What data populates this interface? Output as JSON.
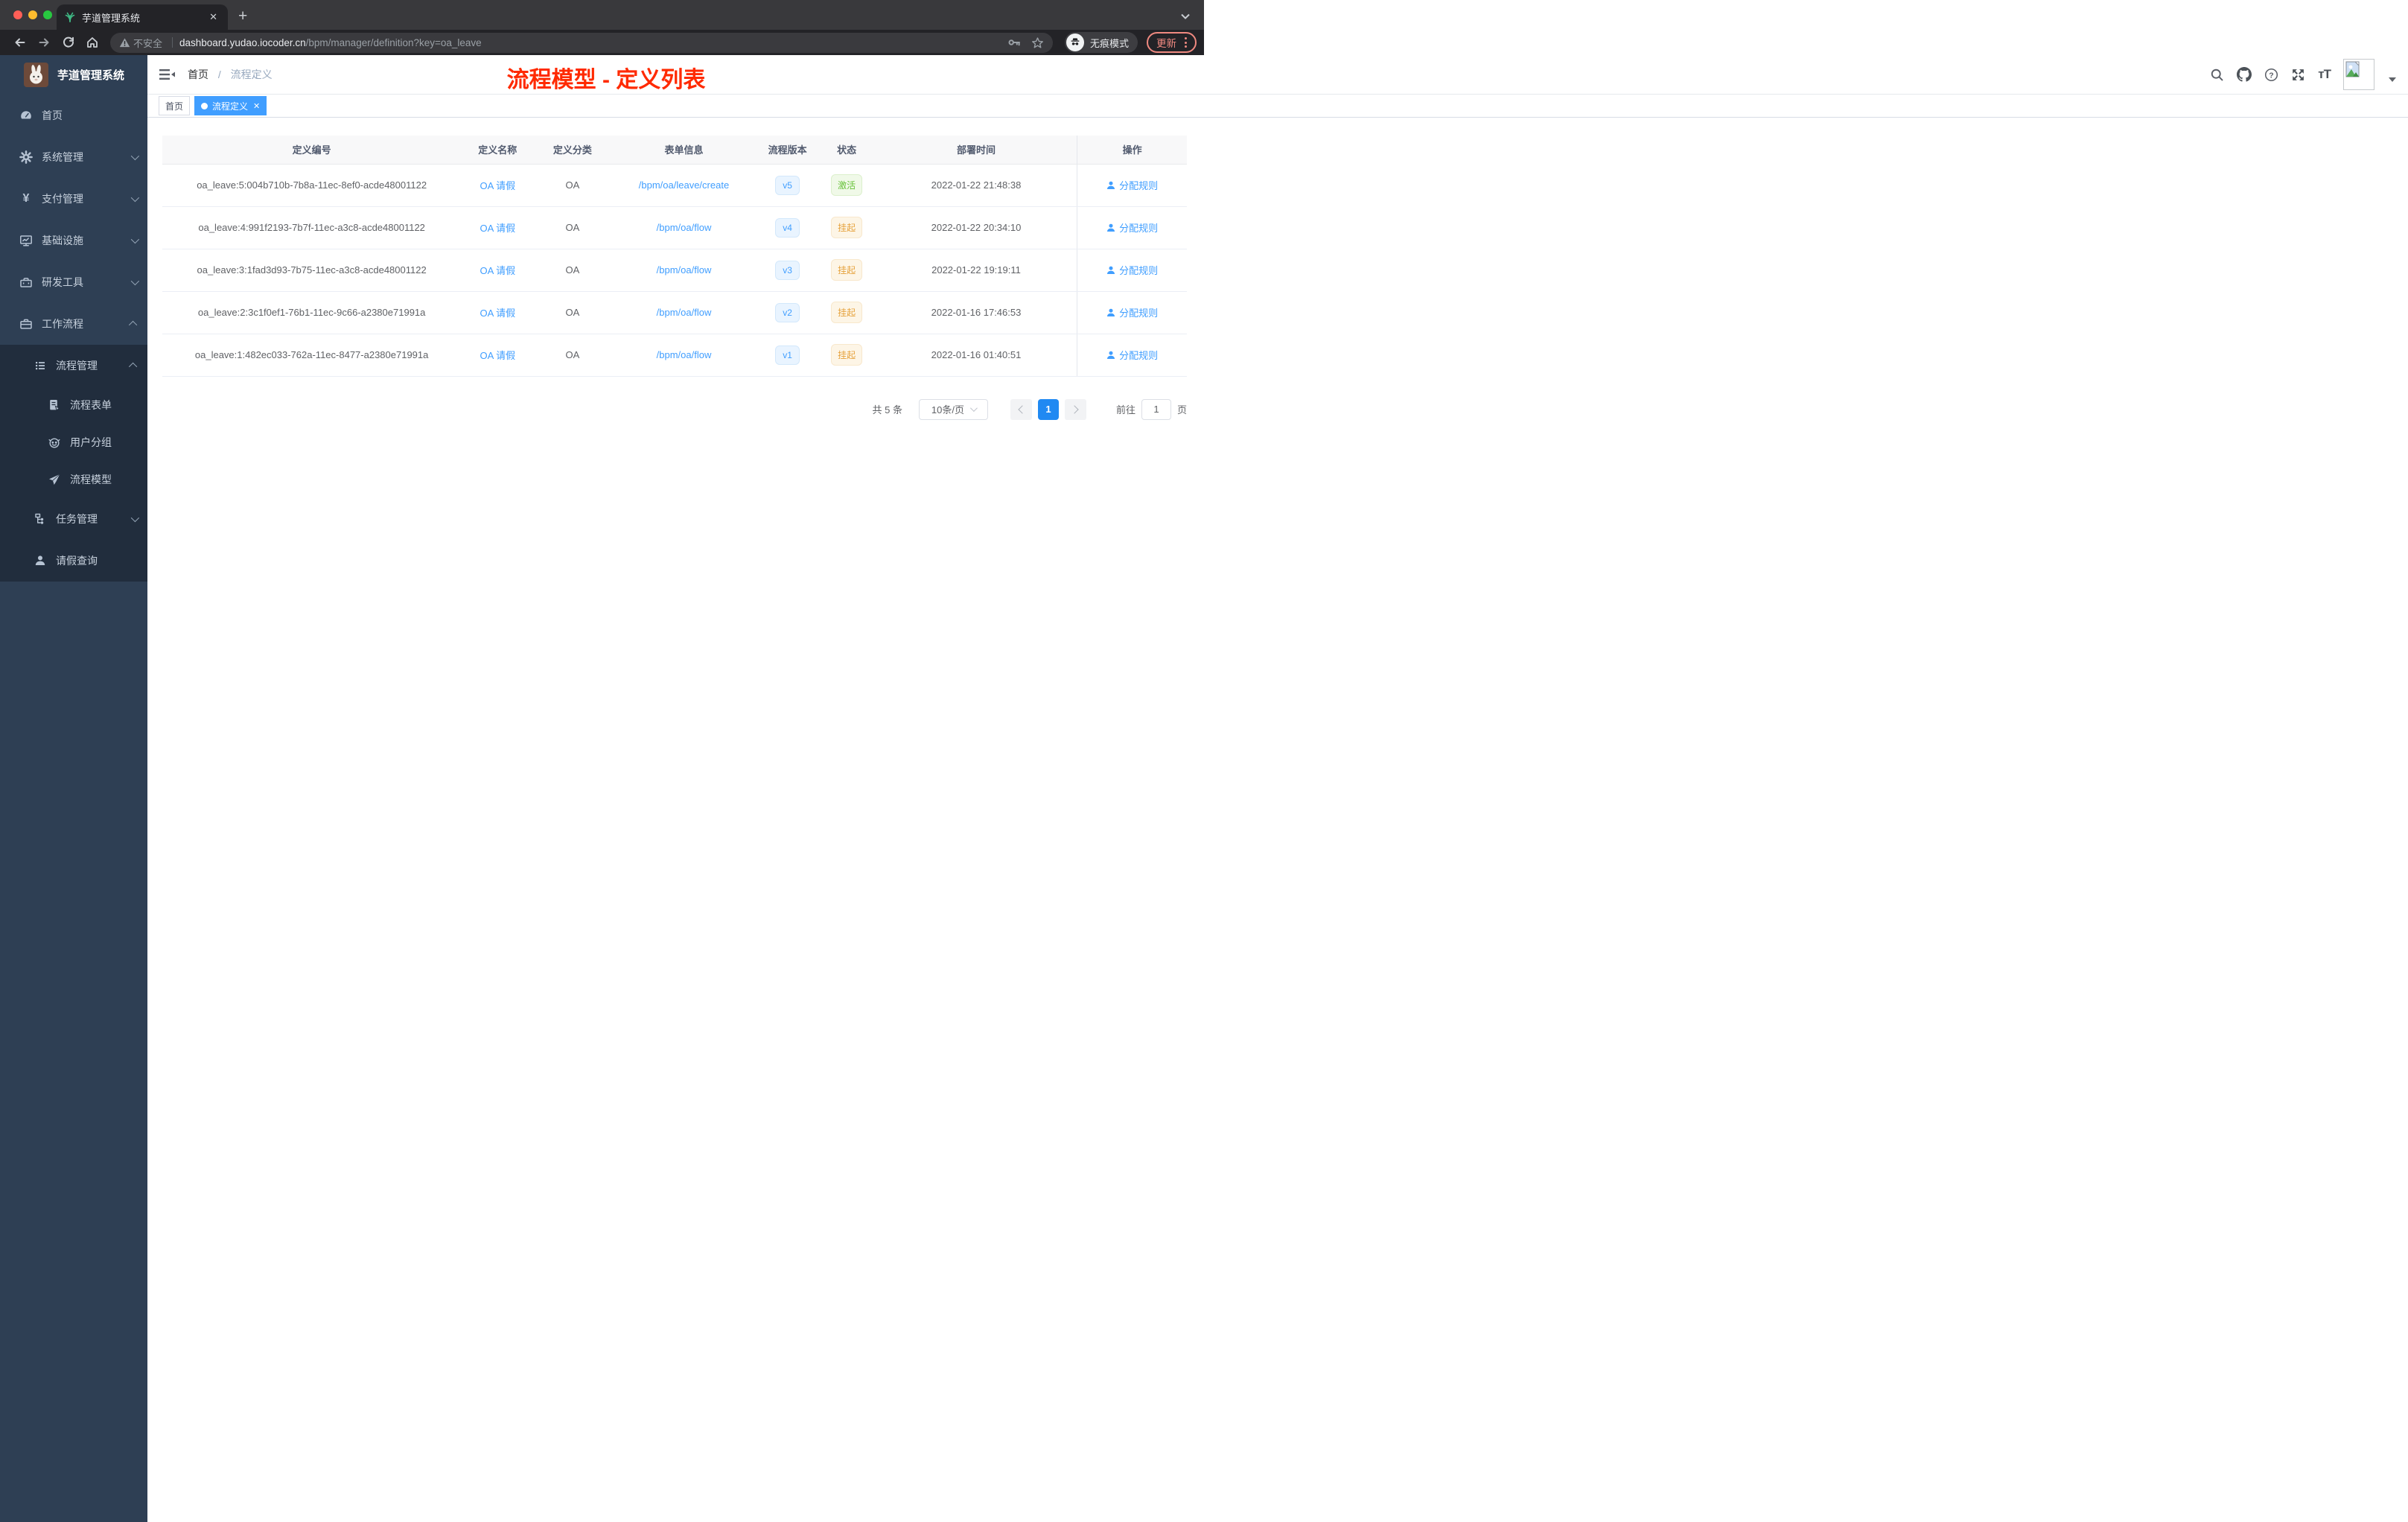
{
  "browser": {
    "tab_title": "芋道管理系统",
    "close_glyph": "✕",
    "new_tab_glyph": "+",
    "security_label": "不安全",
    "url_domain": "dashboard.yudao.iocoder.cn",
    "url_path": "/bpm/manager/definition?key=oa_leave",
    "incognito_label": "无痕模式",
    "update_label": "更新"
  },
  "sidebar": {
    "logo_title": "芋道管理系统",
    "items": [
      {
        "icon": "dashboard-icon",
        "label": "首页"
      },
      {
        "icon": "gear-icon",
        "label": "系统管理"
      },
      {
        "icon": "yen-icon",
        "label": "支付管理",
        "yen": "¥"
      },
      {
        "icon": "monitor-icon",
        "label": "基础设施"
      },
      {
        "icon": "toolbox-icon",
        "label": "研发工具"
      },
      {
        "icon": "briefcase-icon",
        "label": "工作流程"
      },
      {
        "icon": "list-icon",
        "label": "流程管理"
      },
      {
        "icon": "form-icon",
        "label": "流程表单"
      },
      {
        "icon": "robot-icon",
        "label": "用户分组"
      },
      {
        "icon": "plane-icon",
        "label": "流程模型"
      },
      {
        "icon": "tree-icon",
        "label": "任务管理"
      },
      {
        "icon": "user-icon",
        "label": "请假查询"
      }
    ]
  },
  "navbar": {
    "breadcrumb_home": "首页",
    "breadcrumb_sep": "/",
    "breadcrumb_current": "流程定义"
  },
  "overlay_title": "流程模型 - 定义列表",
  "tags": {
    "home": "首页",
    "active": "流程定义",
    "close": "✕"
  },
  "table": {
    "headers": [
      "定义编号",
      "定义名称",
      "定义分类",
      "表单信息",
      "流程版本",
      "状态",
      "部署时间",
      "操作"
    ],
    "rows": [
      {
        "id": "oa_leave:5:004b710b-7b8a-11ec-8ef0-acde48001122",
        "name": "OA 请假",
        "category": "OA",
        "form": "/bpm/oa/leave/create",
        "version": "v5",
        "status": "激活",
        "deploy_time": "2022-01-22 21:48:38",
        "action": "分配规则"
      },
      {
        "id": "oa_leave:4:991f2193-7b7f-11ec-a3c8-acde48001122",
        "name": "OA 请假",
        "category": "OA",
        "form": "/bpm/oa/flow",
        "version": "v4",
        "status": "挂起",
        "deploy_time": "2022-01-22 20:34:10",
        "action": "分配规则"
      },
      {
        "id": "oa_leave:3:1fad3d93-7b75-11ec-a3c8-acde48001122",
        "name": "OA 请假",
        "category": "OA",
        "form": "/bpm/oa/flow",
        "version": "v3",
        "status": "挂起",
        "deploy_time": "2022-01-22 19:19:11",
        "action": "分配规则"
      },
      {
        "id": "oa_leave:2:3c1f0ef1-76b1-11ec-9c66-a2380e71991a",
        "name": "OA 请假",
        "category": "OA",
        "form": "/bpm/oa/flow",
        "version": "v2",
        "status": "挂起",
        "deploy_time": "2022-01-16 17:46:53",
        "action": "分配规则"
      },
      {
        "id": "oa_leave:1:482ec033-762a-11ec-8477-a2380e71991a",
        "name": "OA 请假",
        "category": "OA",
        "form": "/bpm/oa/flow",
        "version": "v1",
        "status": "挂起",
        "deploy_time": "2022-01-16 01:40:51",
        "action": "分配规则"
      }
    ]
  },
  "pagination": {
    "total": "共 5 条",
    "page_size": "10条/页",
    "page": "1",
    "goto": "前往",
    "goto_value": "1",
    "unit": "页"
  },
  "colors": {
    "accent": "#409eff",
    "overlay_red": "#ff2a00",
    "status_active": "#67c23a",
    "status_suspend": "#e6a23c",
    "update_chip": "#ef8980",
    "sidebar_bg": "#2e3f54",
    "sidebar_nested_bg": "#212d3d"
  }
}
